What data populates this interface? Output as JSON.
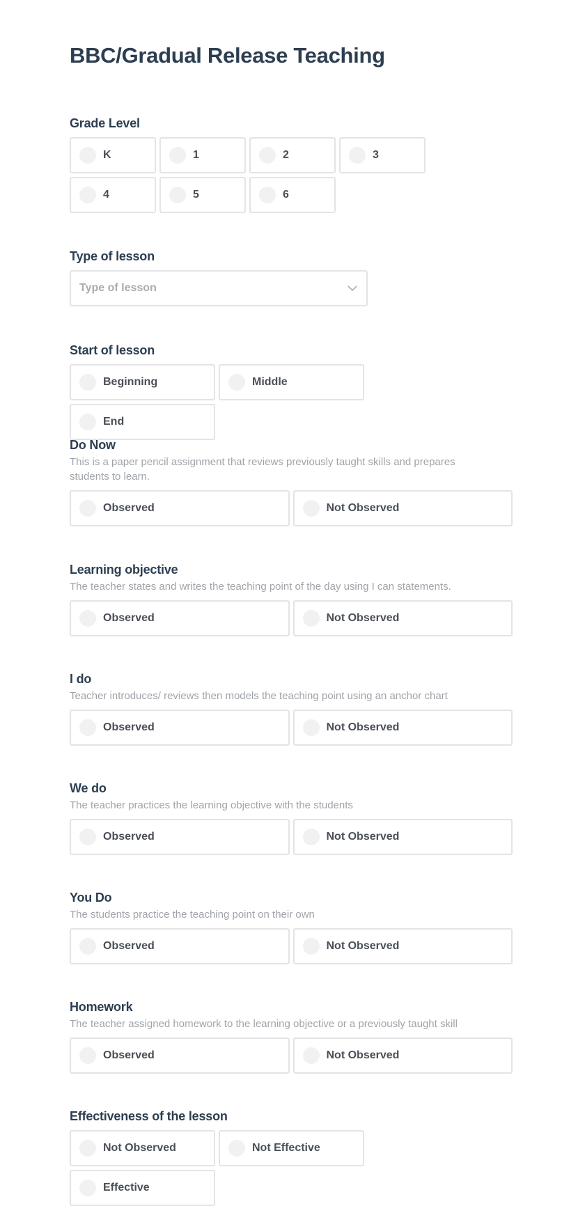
{
  "form": {
    "title": "BBC/Gradual Release Teaching",
    "grade_level": {
      "label": "Grade Level",
      "options": [
        "K",
        "1",
        "2",
        "3",
        "4",
        "5",
        "6"
      ]
    },
    "type_of_lesson": {
      "label": "Type of lesson",
      "placeholder": "Type of lesson"
    },
    "start_of_lesson": {
      "label": "Start of lesson",
      "options": [
        "Beginning",
        "Middle",
        "End"
      ]
    },
    "do_now": {
      "label": "Do Now",
      "description": "This is a paper pencil assignment that reviews previously taught skills and prepares students to learn.",
      "options": [
        "Observed",
        "Not Observed"
      ]
    },
    "learning_objective": {
      "label": "Learning objective",
      "description": "The teacher states and writes the teaching point of the day using I can statements.",
      "options": [
        "Observed",
        "Not Observed"
      ]
    },
    "i_do": {
      "label": "I do",
      "description": "Teacher introduces/ reviews then models the teaching point using an anchor chart",
      "options": [
        "Observed",
        "Not Observed"
      ]
    },
    "we_do": {
      "label": "We do",
      "description": "The teacher practices the learning objective with the students",
      "options": [
        "Observed",
        "Not Observed"
      ]
    },
    "you_do": {
      "label": "You Do",
      "description": "The students practice the teaching point on their own",
      "options": [
        "Observed",
        "Not Observed"
      ]
    },
    "homework": {
      "label": "Homework",
      "description": "The teacher assigned homework to the learning objective or a previously taught skill",
      "options": [
        "Observed",
        "Not Observed"
      ]
    },
    "effectiveness": {
      "label": "Effectiveness of the lesson",
      "options": [
        "Not Observed",
        "Not Effective",
        "Effective"
      ]
    }
  },
  "colors": {
    "heading": "#2c3e50",
    "description": "#a0a4aa",
    "border": "#e4e4e6",
    "radio_fill": "#f1f1f2",
    "option_text": "#4a4f57"
  }
}
